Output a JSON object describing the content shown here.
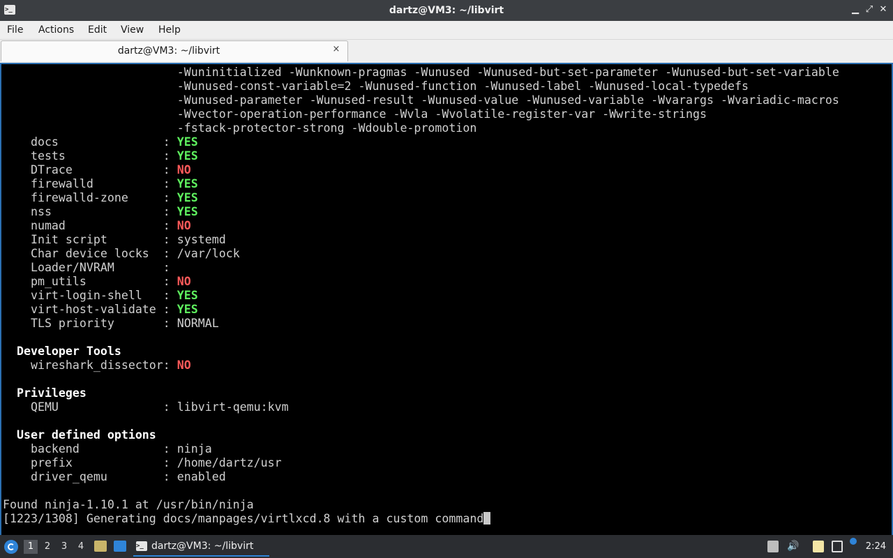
{
  "window": {
    "title": "dartz@VM3: ~/libvirt",
    "icon": "terminal-icon",
    "controls": [
      "minimize",
      "restore",
      "close"
    ]
  },
  "menu": {
    "items": [
      "File",
      "Actions",
      "Edit",
      "View",
      "Help"
    ]
  },
  "tab": {
    "label": "dartz@VM3: ~/libvirt",
    "close_glyph": "×"
  },
  "terminal": {
    "lines": [
      {
        "indent": "                         ",
        "text": "-Wuninitialized -Wunknown-pragmas -Wunused -Wunused-but-set-parameter -Wunused-but-set-variable"
      },
      {
        "indent": "                         ",
        "text": "-Wunused-const-variable=2 -Wunused-function -Wunused-label -Wunused-local-typedefs"
      },
      {
        "indent": "                         ",
        "text": "-Wunused-parameter -Wunused-result -Wunused-value -Wunused-variable -Wvarargs -Wvariadic-macros"
      },
      {
        "indent": "                         ",
        "text": "-Wvector-operation-performance -Wvla -Wvolatile-register-var -Wwrite-strings"
      },
      {
        "indent": "                         ",
        "text": "-fstack-protector-strong -Wdouble-promotion"
      },
      {
        "key": "    docs               : ",
        "value": "YES",
        "kind": "yes"
      },
      {
        "key": "    tests              : ",
        "value": "YES",
        "kind": "yes"
      },
      {
        "key": "    DTrace             : ",
        "value": "NO",
        "kind": "no"
      },
      {
        "key": "    firewalld          : ",
        "value": "YES",
        "kind": "yes"
      },
      {
        "key": "    firewalld-zone     : ",
        "value": "YES",
        "kind": "yes"
      },
      {
        "key": "    nss                : ",
        "value": "YES",
        "kind": "yes"
      },
      {
        "key": "    numad              : ",
        "value": "NO",
        "kind": "no"
      },
      {
        "key": "    Init script        : ",
        "value": "systemd",
        "kind": "plain"
      },
      {
        "key": "    Char device locks  : ",
        "value": "/var/lock",
        "kind": "plain"
      },
      {
        "key": "    Loader/NVRAM       : ",
        "value": "",
        "kind": "plain"
      },
      {
        "key": "    pm_utils           : ",
        "value": "NO",
        "kind": "no"
      },
      {
        "key": "    virt-login-shell   : ",
        "value": "YES",
        "kind": "yes"
      },
      {
        "key": "    virt-host-validate : ",
        "value": "YES",
        "kind": "yes"
      },
      {
        "key": "    TLS priority       : ",
        "value": "NORMAL",
        "kind": "plain"
      },
      {
        "text": ""
      },
      {
        "header": "  Developer Tools"
      },
      {
        "key": "    wireshark_dissector: ",
        "value": "NO",
        "kind": "no"
      },
      {
        "text": ""
      },
      {
        "header": "  Privileges"
      },
      {
        "key": "    QEMU               : ",
        "value": "libvirt-qemu:kvm",
        "kind": "plain"
      },
      {
        "text": ""
      },
      {
        "header": "  User defined options"
      },
      {
        "key": "    backend            : ",
        "value": "ninja",
        "kind": "plain"
      },
      {
        "key": "    prefix             : ",
        "value": "/home/dartz/usr",
        "kind": "plain"
      },
      {
        "key": "    driver_qemu        : ",
        "value": "enabled",
        "kind": "plain"
      },
      {
        "text": ""
      },
      {
        "text": "Found ninja-1.10.1 at /usr/bin/ninja"
      },
      {
        "text": "[1223/1308] Generating docs/manpages/virtlxcd.8 with a custom command",
        "cursor": true
      }
    ]
  },
  "taskbar": {
    "workspaces": [
      "1",
      "2",
      "3",
      "4"
    ],
    "active_workspace": "1",
    "task_label": "dartz@VM3: ~/libvirt",
    "tray_icons": [
      "clipboard-icon",
      "volume-icon",
      "files-icon",
      "network-icon"
    ],
    "clock": "2:24"
  }
}
